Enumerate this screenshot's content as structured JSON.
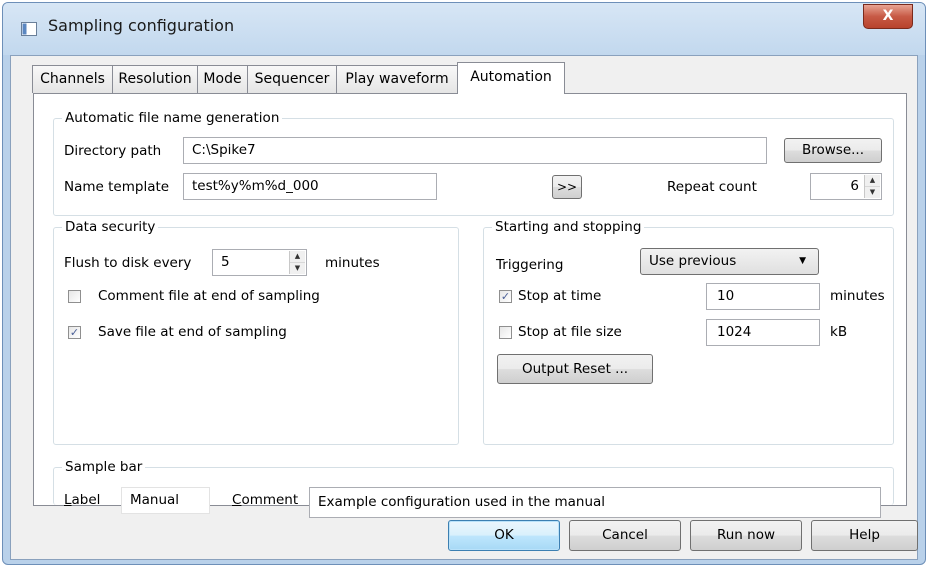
{
  "window": {
    "title": "Sampling configuration",
    "close_label": "X"
  },
  "tabs": [
    {
      "label": "Channels"
    },
    {
      "label": "Resolution"
    },
    {
      "label": "Mode"
    },
    {
      "label": "Sequencer"
    },
    {
      "label": "Play waveform"
    },
    {
      "label": "Automation"
    }
  ],
  "active_tab": "Automation",
  "auto_file": {
    "legend": "Automatic file name generation",
    "dir_label": "Directory path",
    "dir_value": "C:\\Spike7",
    "browse_label": "Browse...",
    "name_label": "Name template",
    "name_value": "test%y%m%d_000",
    "insert_label": ">>",
    "repeat_label": "Repeat count",
    "repeat_value": "6"
  },
  "data_security": {
    "legend": "Data security",
    "flush_label": "Flush to disk every",
    "flush_value": "5",
    "flush_unit": "minutes",
    "comment_label": "Comment file at end of sampling",
    "comment_checked": false,
    "save_label": "Save file at end of sampling",
    "save_checked": true
  },
  "start_stop": {
    "legend": "Starting and stopping",
    "trigger_label": "Triggering",
    "trigger_value": "Use previous",
    "stop_time_label": "Stop at time",
    "stop_time_checked": true,
    "stop_time_value": "10",
    "stop_time_unit": "minutes",
    "stop_size_label": "Stop at file size",
    "stop_size_checked": false,
    "stop_size_value": "1024",
    "stop_size_unit": "kB",
    "output_reset_label": "Output Reset ..."
  },
  "sample_bar": {
    "legend": "Sample bar",
    "label_prefix": "L",
    "label_rest": "abel",
    "label_value": "Manual",
    "comment_prefix": "C",
    "comment_rest": "omment",
    "comment_value": "Example configuration used in the manual"
  },
  "buttons": {
    "ok": "OK",
    "cancel": "Cancel",
    "run_now": "Run now",
    "help": "Help"
  },
  "check_glyph": "✓"
}
